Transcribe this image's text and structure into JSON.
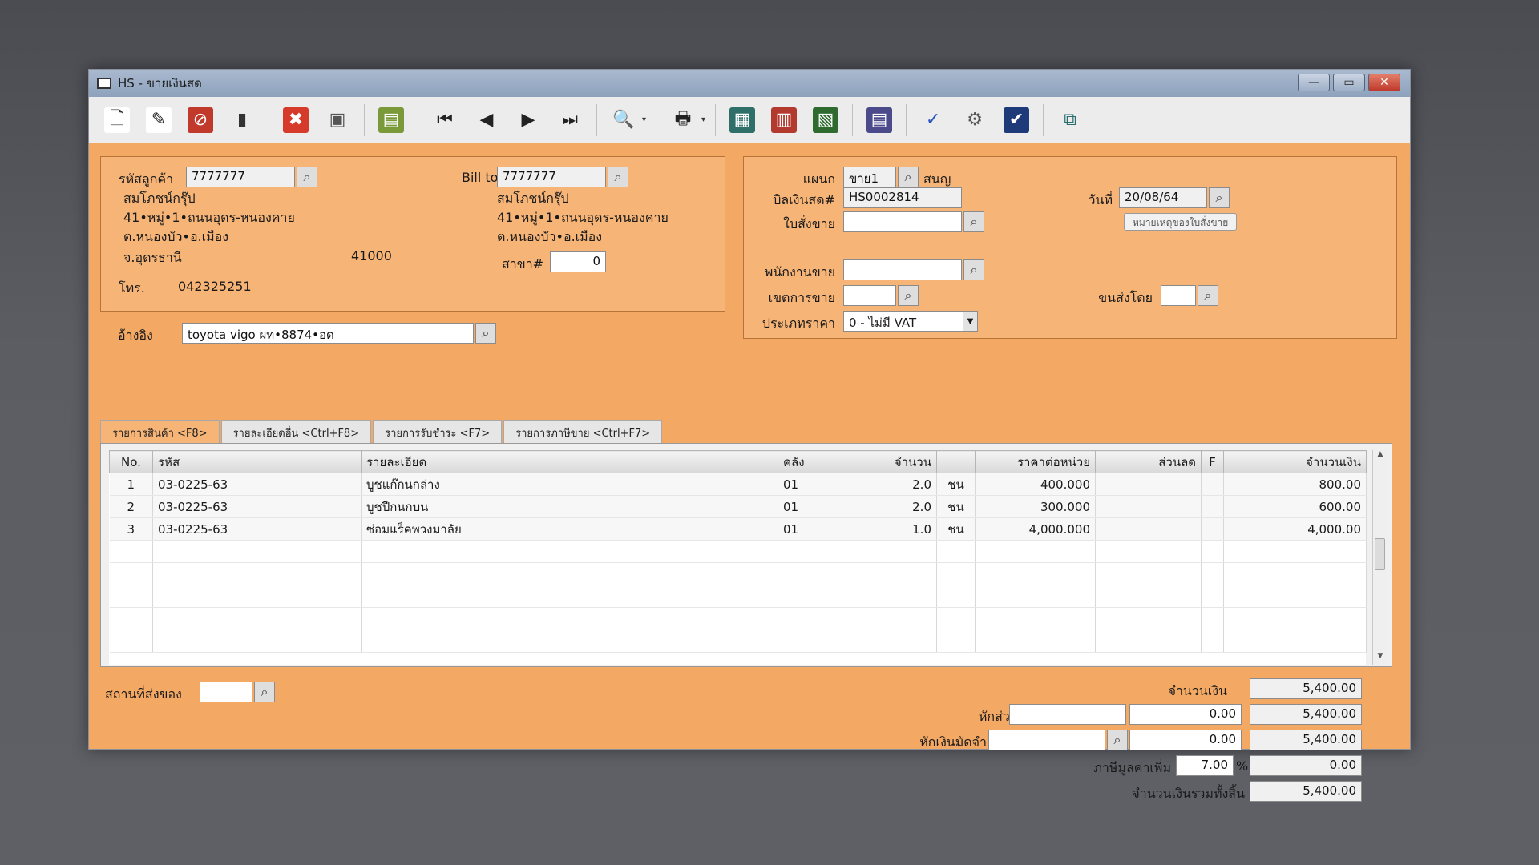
{
  "window": {
    "title": "HS - ขายเงินสด",
    "minimize": "—",
    "maximize": "▭",
    "close": "✕"
  },
  "toolbar": [
    {
      "name": "new-icon",
      "glyph": "🗋",
      "bg": "#ffffff",
      "fg": "#333333"
    },
    {
      "name": "edit-icon",
      "glyph": "✎",
      "bg": "#ffffff",
      "fg": "#222222"
    },
    {
      "name": "cancel-doc-icon",
      "glyph": "⊘",
      "bg": "#c0392b",
      "fg": "#ffffff"
    },
    {
      "name": "delete-bin-icon",
      "glyph": "▮",
      "bg": "#ececec",
      "fg": "#333333"
    },
    {
      "name": "sep"
    },
    {
      "name": "close-icon",
      "glyph": "✖",
      "bg": "#d63a2b",
      "fg": "#ffffff"
    },
    {
      "name": "save-icon",
      "glyph": "▣",
      "bg": "#ececec",
      "fg": "#555555"
    },
    {
      "name": "sep"
    },
    {
      "name": "books-icon",
      "glyph": "▤",
      "bg": "#7a9a3a",
      "fg": "#ffffff"
    },
    {
      "name": "sep"
    },
    {
      "name": "first-record-icon",
      "glyph": "⏮",
      "bg": "#ececec",
      "fg": "#222222"
    },
    {
      "name": "previous-record-icon",
      "glyph": "◀",
      "bg": "#ececec",
      "fg": "#222222"
    },
    {
      "name": "next-record-icon",
      "glyph": "▶",
      "bg": "#ececec",
      "fg": "#222222"
    },
    {
      "name": "last-record-icon",
      "glyph": "⏭",
      "bg": "#ececec",
      "fg": "#222222"
    },
    {
      "name": "sep"
    },
    {
      "name": "preview-icon",
      "glyph": "🔍",
      "bg": "#ececec",
      "fg": "#222222",
      "caret": "▾"
    },
    {
      "name": "sep"
    },
    {
      "name": "print-icon",
      "glyph": "🖶",
      "bg": "#ececec",
      "fg": "#222222",
      "caret": "▾"
    },
    {
      "name": "sep"
    },
    {
      "name": "report-grid-icon",
      "glyph": "▦",
      "bg": "#2f6f6a",
      "fg": "#ffffff"
    },
    {
      "name": "report-stack-icon",
      "glyph": "▥",
      "bg": "#b33a2e",
      "fg": "#ffffff"
    },
    {
      "name": "report-chart-icon",
      "glyph": "▧",
      "bg": "#2f6b2f",
      "fg": "#ffffff"
    },
    {
      "name": "sep"
    },
    {
      "name": "regional-icon",
      "glyph": "▤",
      "bg": "#4b4a8a",
      "fg": "#ffffff"
    },
    {
      "name": "sep"
    },
    {
      "name": "approve-ok-icon",
      "glyph": "✓",
      "bg": "#ececec",
      "fg": "#2a52be"
    },
    {
      "name": "settings-icon",
      "glyph": "⚙",
      "bg": "#ececec",
      "fg": "#555555"
    },
    {
      "name": "confirm-ok-icon",
      "glyph": "✔",
      "bg": "#1e3a78",
      "fg": "#ffffff"
    },
    {
      "name": "sep"
    },
    {
      "name": "network-icon",
      "glyph": "⧉",
      "bg": "#ececec",
      "fg": "#2a6f6f"
    }
  ],
  "customer": {
    "code_label": "รหัสลูกค้า",
    "code": "7777777",
    "name": "สมโภชน์กรุ๊ป",
    "address1": "41•หมู่•1•ถนนอุดร-หนองคาย",
    "address2": "ต.หนองบัว•อ.เมือง",
    "province": "จ.อุดรธานี",
    "postcode": "41000",
    "phone_label": "โทร.",
    "phone": "042325251",
    "ref_label": "อ้างอิง",
    "ref": "toyota vigo ผท•8874•อด"
  },
  "billto": {
    "label": "Bill to",
    "code": "7777777",
    "name": "สมโภชน์กรุ๊ป",
    "address1": "41•หมู่•1•ถนนอุดร-หนองคาย",
    "address2": "ต.หนองบัว•อ.เมือง",
    "branch_label": "สาขา#",
    "branch": "0"
  },
  "doc": {
    "dept_label": "แผนก",
    "dept": "ขาย1",
    "dept_name": "สนญ",
    "bill_label": "บิลเงินสด#",
    "bill_no": "HS0002814",
    "date_label": "วันที่",
    "date": "20/08/64",
    "order_label": "ใบสั่งขาย",
    "order_no": "",
    "order_note_btn": "หมายเหตุของใบสั่งขาย",
    "sales_label": "พนักงานขาย",
    "sales": "",
    "area_label": "เขตการขาย",
    "area": "",
    "ship_label": "ขนส่งโดย",
    "ship": "",
    "price_type_label": "ประเภทราคา",
    "price_type": "0 - ไม่มี VAT"
  },
  "tabs": [
    "รายการสินค้า <F8>",
    "รายละเอียดอื่น <Ctrl+F8>",
    "รายการรับชำระ <F7>",
    "รายการภาษีขาย <Ctrl+F7>"
  ],
  "grid": {
    "headers": [
      "No.",
      "รหัส",
      "รายละเอียด",
      "คลัง",
      "จำนวน",
      "",
      "ราคาต่อหน่วย",
      "ส่วนลด",
      "F",
      "จำนวนเงิน"
    ],
    "rows": [
      [
        "1",
        "03-0225-63",
        "บูชแก๊กนกล่าง",
        "01",
        "2.0",
        "ชน",
        "400.000",
        "",
        "",
        "800.00"
      ],
      [
        "2",
        "03-0225-63",
        "บูชปีกนกบน",
        "01",
        "2.0",
        "ชน",
        "300.000",
        "",
        "",
        "600.00"
      ],
      [
        "3",
        "03-0225-63",
        "ซ่อมแร็คพวงมาลัย",
        "01",
        "1.0",
        "ชน",
        "4,000.000",
        "",
        "",
        "4,000.00"
      ]
    ]
  },
  "footer": {
    "delivery_label": "สถานที่ส่งของ",
    "delivery": "",
    "amount_label": "จำนวนเงิน",
    "amount": "5,400.00",
    "discount_label": "หักส่วนลด",
    "discount_text": "",
    "discount_value": "0.00",
    "after_discount": "5,400.00",
    "deposit_label": "หักเงินมัดจำ",
    "deposit_text": "",
    "deposit_value": "0.00",
    "after_deposit": "5,400.00",
    "vat_label": "ภาษีมูลค่าเพิ่ม",
    "vat_rate": "7.00",
    "vat_pct": "%",
    "vat_amount": "0.00",
    "total_label": "จำนวนเงินรวมทั้งสิ้น",
    "total": "5,400.00"
  }
}
